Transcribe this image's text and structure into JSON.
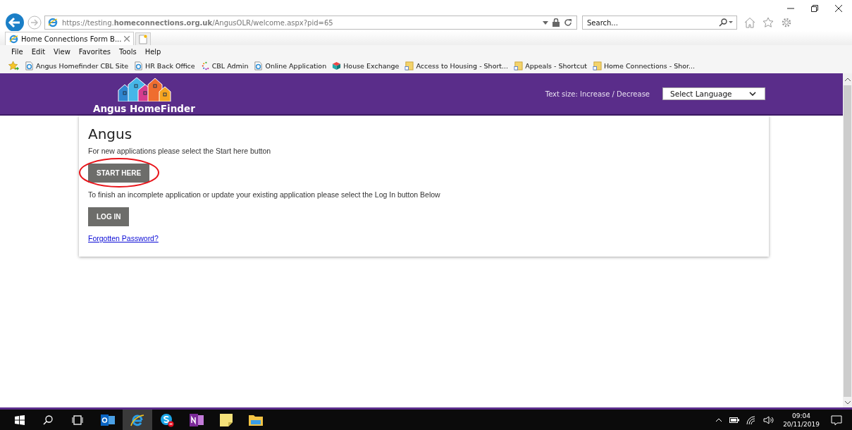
{
  "address_bar": {
    "url": "https://testing.**homeconnections.org.uk**/AngusOLR/welcome.aspx?pid=65"
  },
  "search": {
    "placeholder": "Search..."
  },
  "tabs": [
    {
      "label": "Home Connections Form B...",
      "selected": true
    }
  ],
  "menu": [
    "File",
    "Edit",
    "View",
    "Favorites",
    "Tools",
    "Help"
  ],
  "favorites": [
    {
      "label": "Angus Homefinder CBL Site",
      "kind": "page"
    },
    {
      "label": "HR Back Office",
      "kind": "page"
    },
    {
      "label": "CBL Admin",
      "kind": "dots"
    },
    {
      "label": "Online Application",
      "kind": "page"
    },
    {
      "label": "House Exchange",
      "kind": "cube"
    },
    {
      "label": "Access to Housing - Short...",
      "kind": "shortcut"
    },
    {
      "label": "Appeals - Shortcut",
      "kind": "shortcut"
    },
    {
      "label": "Home Connections - Shor...",
      "kind": "shortcut"
    }
  ],
  "site_header": {
    "logo_text": "Angus HomeFinder",
    "text_size": "Text size: Increase / Decrease",
    "language_select": "Select Language"
  },
  "content": {
    "heading": "Angus",
    "items": [
      {
        "kind": "text",
        "text": "For new applications please select the Start here button"
      },
      {
        "kind": "button",
        "text": "START HERE",
        "circled": true
      },
      {
        "kind": "text",
        "text": "To finish an incomplete application or update your existing application please select the Log In button Below"
      },
      {
        "kind": "button",
        "text": "LOG IN",
        "circled": false
      },
      {
        "kind": "link",
        "text": "Forgotten Password?"
      }
    ]
  },
  "taskbar": {
    "apps": [
      {
        "kind": "outlook",
        "selected": false
      },
      {
        "kind": "ie",
        "selected": true
      },
      {
        "kind": "skype",
        "selected": false
      },
      {
        "kind": "onenote",
        "selected": false
      },
      {
        "kind": "notes",
        "selected": false
      },
      {
        "kind": "folder",
        "selected": false
      }
    ],
    "time": "09:04",
    "date": "20/11/2019"
  }
}
